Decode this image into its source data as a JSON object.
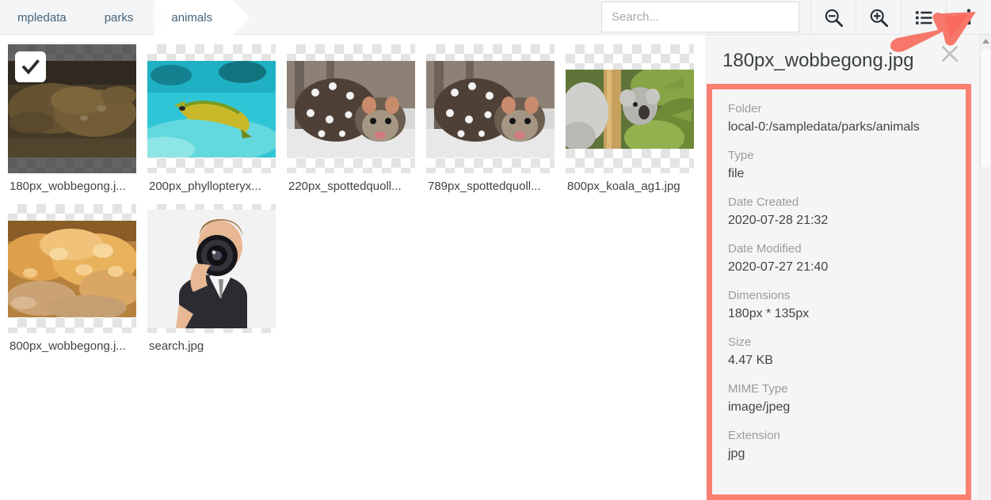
{
  "breadcrumb": {
    "items": [
      {
        "label": "mpledata",
        "state": "truncated"
      },
      {
        "label": "parks",
        "state": "normal"
      },
      {
        "label": "animals",
        "state": "active"
      }
    ]
  },
  "search": {
    "placeholder": "Search...",
    "value": ""
  },
  "toolbar": {
    "icons": [
      {
        "name": "zoom-out-icon",
        "title": "Zoom out"
      },
      {
        "name": "zoom-in-icon",
        "title": "Zoom in"
      },
      {
        "name": "list-view-icon",
        "title": "List view"
      },
      {
        "name": "info-icon",
        "title": "Details"
      }
    ]
  },
  "grid": {
    "files": [
      {
        "name": "180px_wobbegong.j...",
        "full_name": "180px_wobbegong.jpg",
        "selected": true,
        "art": "wobbegong-dark"
      },
      {
        "name": "200px_phyllopteryx...",
        "full_name": "200px_phyllopteryx.jpg",
        "selected": false,
        "art": "seadragon"
      },
      {
        "name": "220px_spottedquoll...",
        "full_name": "220px_spottedquoll.jpg",
        "selected": false,
        "art": "quoll"
      },
      {
        "name": "789px_spottedquoll...",
        "full_name": "789px_spottedquoll.jpg",
        "selected": false,
        "art": "quoll"
      },
      {
        "name": "800px_koala_ag1.jpg",
        "full_name": "800px_koala_ag1.jpg",
        "selected": false,
        "art": "koala"
      },
      {
        "name": "800px_wobbegong.j...",
        "full_name": "800px_wobbegong.jpg",
        "selected": false,
        "art": "wobbegong-light"
      },
      {
        "name": "search.jpg",
        "full_name": "search.jpg",
        "selected": false,
        "art": "camera-man"
      }
    ]
  },
  "details": {
    "title": "180px_wobbegong.jpg",
    "close_label": "×",
    "highlight_color": "#fa8072",
    "fields": [
      {
        "label": "Folder",
        "value": "local-0:/sampledata/parks/animals"
      },
      {
        "label": "Type",
        "value": "file"
      },
      {
        "label": "Date Created",
        "value": "2020-07-28 21:32"
      },
      {
        "label": "Date Modified",
        "value": "2020-07-27 21:40"
      },
      {
        "label": "Dimensions",
        "value": "180px * 135px"
      },
      {
        "label": "Size",
        "value": "4.47 KB"
      },
      {
        "label": "MIME Type",
        "value": "image/jpeg"
      },
      {
        "label": "Extension",
        "value": "jpg"
      }
    ]
  },
  "annotation": {
    "arrow_color": "#fa6a5e",
    "points_to": "info-icon"
  }
}
